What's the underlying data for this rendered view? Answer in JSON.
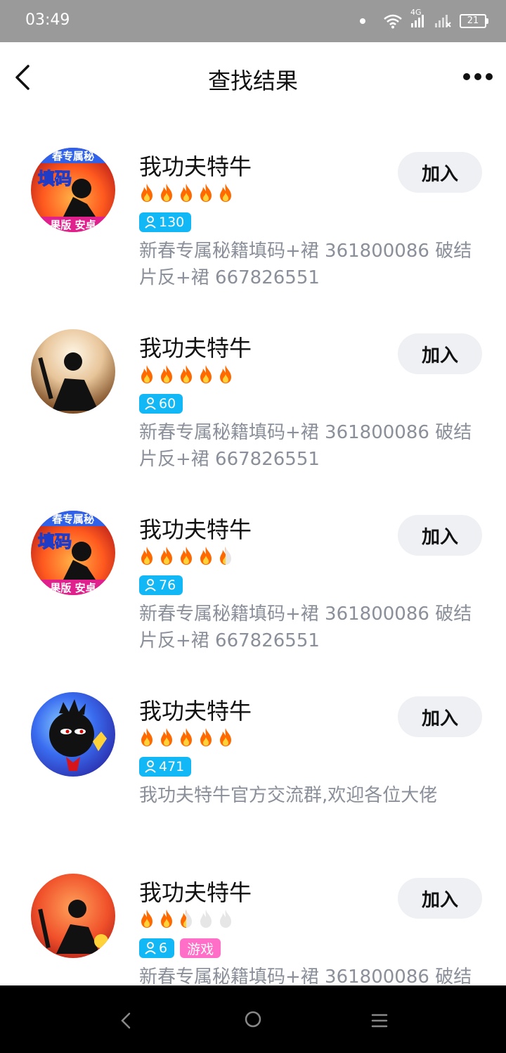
{
  "status_bar": {
    "time": "03:49",
    "network": "4G",
    "battery": "21"
  },
  "header": {
    "title": "查找结果"
  },
  "colors": {
    "member_badge": "#12b7f5",
    "tag_badge": "#ff6ec7",
    "flame": "#ff6a00",
    "flame_empty": "#e6e6e6"
  },
  "join_label": "加入",
  "groups": [
    {
      "name": "我功夫特牛",
      "rating": 5,
      "members": "130",
      "tag": "",
      "description": "新春专属秘籍填码+裙 361800086 破结片反+裙 667826551"
    },
    {
      "name": "我功夫特牛",
      "rating": 5,
      "members": "60",
      "tag": "",
      "description": "新春专属秘籍填码+裙 361800086 破结片反+裙 667826551"
    },
    {
      "name": "我功夫特牛",
      "rating": 4.5,
      "members": "76",
      "tag": "",
      "description": "新春专属秘籍填码+裙 361800086 破结片反+裙 667826551"
    },
    {
      "name": "我功夫特牛",
      "rating": 5,
      "members": "471",
      "tag": "",
      "description": "我功夫特牛官方交流群,欢迎各位大佬"
    },
    {
      "name": "我功夫特牛",
      "rating": 2.5,
      "members": "6",
      "tag": "游戏",
      "description": "新春专属秘籍填码+裙 361800086 破结"
    }
  ],
  "avatars": [
    {
      "overlay_top": "春专属秘",
      "overlay_mid": "填码",
      "overlay_bottom": "果版 安卓"
    },
    {
      "overlay_top": "",
      "overlay_mid": "",
      "overlay_bottom": ""
    },
    {
      "overlay_top": "春专属秘",
      "overlay_mid": "填码",
      "overlay_bottom": "果版 安卓"
    },
    {
      "overlay_top": "",
      "overlay_mid": "",
      "overlay_bottom": ""
    },
    {
      "overlay_top": "",
      "overlay_mid": "",
      "overlay_bottom": ""
    }
  ]
}
